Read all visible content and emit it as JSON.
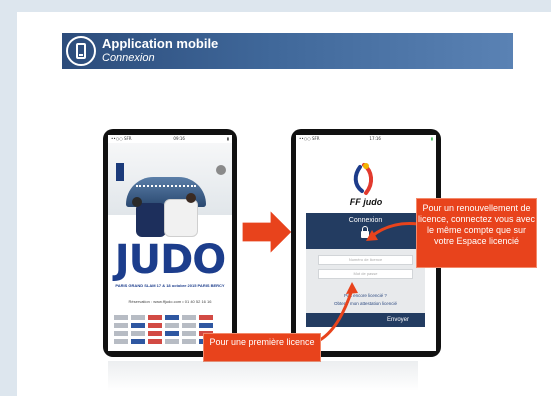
{
  "header": {
    "title": "Application mobile",
    "subtitle": "Connexion",
    "icon": "mobile-phone-icon"
  },
  "left_phone": {
    "status_left": "••○○ SFR",
    "status_time": "09:16",
    "status_right": "▮",
    "poster": {
      "big_word": "JUDO",
      "event_line": "PARIS GRAND SLAM 17 & 18 octobre 2015 PARIS BERCY",
      "reservation_line": "Réservation : www.ffjudo.com • 01 40 52 16 16"
    }
  },
  "right_phone": {
    "status_left": "••○○ SFR",
    "status_time": "17:16",
    "status_right": "▮",
    "logo_text": "FF judo",
    "connexion_title": "Connexion",
    "licence_placeholder": "Numéro de licence",
    "password_placeholder": "Mot de passe",
    "forgot_link": "Pas encore licencié ?",
    "obtain_link": "Obtenir mon attestation licencié",
    "send_button": "Envoyer"
  },
  "callouts": {
    "renewal": "Pour un renouvellement de licence, connectez vous avec le même compte que sur votre Espace licencié",
    "first": "Pour une première licence"
  },
  "colors": {
    "header_blue": "#2c4c7b",
    "callout_orange": "#e8431c",
    "panel_navy": "#233c61"
  }
}
